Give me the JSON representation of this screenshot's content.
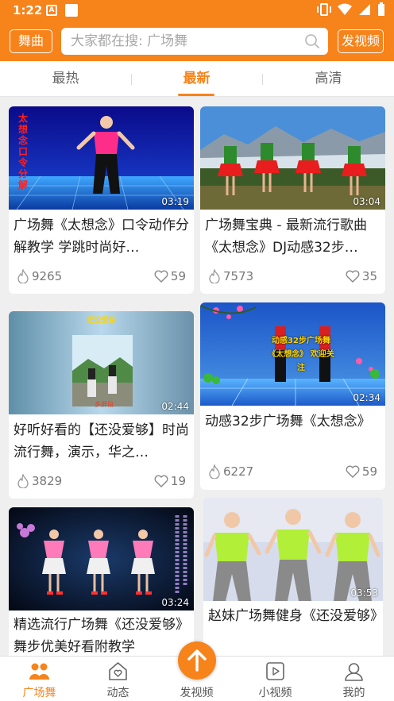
{
  "status_bar": {
    "time": "1:22",
    "a_icon": "A"
  },
  "header": {
    "left_button": "舞曲",
    "search_placeholder": "大家都在搜: 广场舞",
    "right_button": "发视频"
  },
  "tabs": [
    {
      "label": "最热",
      "active": false
    },
    {
      "label": "最新",
      "active": true
    },
    {
      "label": "高清",
      "active": false
    }
  ],
  "videos": [
    {
      "title": "广场舞《太想念》口令动作分解教学 学跳时尚好…",
      "duration": "03:19",
      "views": "9265",
      "likes": "59",
      "thumb_text": "太想念 口令分解"
    },
    {
      "title": "广场舞宝典 - 最新流行歌曲《太想念》DJ动感32步…",
      "duration": "03:04",
      "views": "7573",
      "likes": "35"
    },
    {
      "title": "好听好看的【还没爱够】时尚流行舞，演示，华之…",
      "duration": "02:44",
      "views": "3829",
      "likes": "19",
      "thumb_text": "还没爱够"
    },
    {
      "title": "动感32步广场舞《太想念》",
      "duration": "02:34",
      "views": "6227",
      "likes": "59",
      "thumb_text": "动感32步广场舞 《太想念》 欢迎关注"
    },
    {
      "title": "精选流行广场舞《还没爱够》舞步优美好看附教学",
      "duration": "03:24"
    },
    {
      "title": "赵妹广场舞健身《还没爱够》",
      "duration": "03:53"
    }
  ],
  "bottom_nav": [
    {
      "label": "广场舞",
      "icon": "people-icon",
      "active": true
    },
    {
      "label": "动态",
      "icon": "heart-house-icon",
      "active": false
    },
    {
      "label": "发视频",
      "icon": "upload-arrow-icon",
      "active": false
    },
    {
      "label": "小视频",
      "icon": "play-box-icon",
      "active": false
    },
    {
      "label": "我的",
      "icon": "user-icon",
      "active": false
    }
  ],
  "colors": {
    "accent": "#f7831b"
  }
}
